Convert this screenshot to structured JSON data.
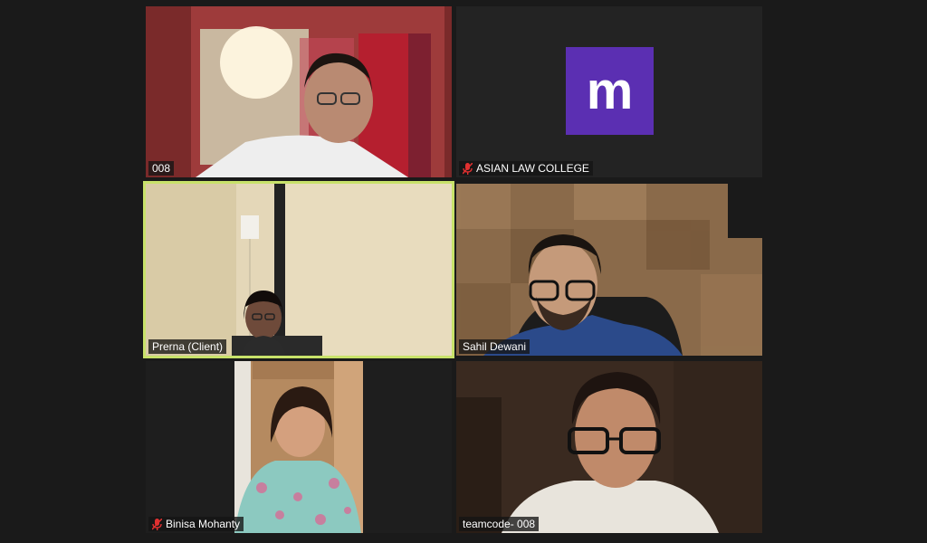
{
  "participants": [
    {
      "name": "008",
      "muted": false
    },
    {
      "name": "ASIAN LAW COLLEGE",
      "muted": true,
      "avatar_letter": "m",
      "avatar_color": "#5b2fb2"
    },
    {
      "name": "Prerna (Client)",
      "muted": false,
      "active_speaker": true
    },
    {
      "name": "Sahil Dewani",
      "muted": false
    },
    {
      "name": "Binisa Mohanty",
      "muted": true
    },
    {
      "name": "teamcode- 008",
      "muted": false
    }
  ],
  "colors": {
    "active_border": "#c8e26a",
    "muted_icon": "#e03030",
    "background": "#1a1a1a"
  }
}
